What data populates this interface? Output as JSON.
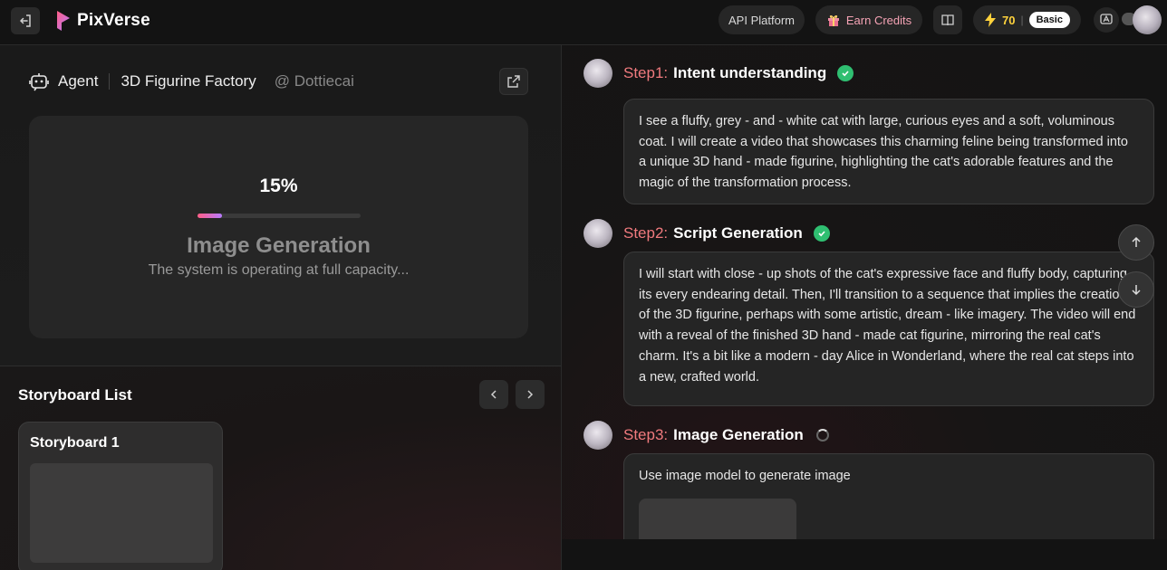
{
  "header": {
    "brand": "PixVerse",
    "api_platform": "API Platform",
    "earn_credits": "Earn Credits",
    "credits": "70",
    "plan": "Basic",
    "brand_gradient": [
      "#ff5e86",
      "#b77bff"
    ],
    "icons": {
      "back": "exit-icon",
      "gift": "gift-icon",
      "book": "book-icon",
      "bolt": "lightning-icon",
      "ai": "ai-assistant-icon"
    }
  },
  "agent": {
    "label": "Agent",
    "title": "3D Figurine Factory",
    "handle": "@ Dottiecai"
  },
  "generation": {
    "percent_text": "15%",
    "progress": 0.15,
    "title": "Image Generation",
    "subtitle": "The system is operating at full capacity..."
  },
  "storyboard": {
    "title": "Storyboard List",
    "cards": [
      {
        "title": "Storyboard 1"
      }
    ]
  },
  "steps": [
    {
      "num": "Step1:",
      "name": "Intent understanding",
      "status": "done",
      "text": "I see a fluffy, grey - and - white cat with large, curious eyes and a soft, voluminous coat. I will create a video that showcases this charming feline being transformed into a unique 3D hand - made figurine, highlighting the cat's adorable features and the magic of the transformation process."
    },
    {
      "num": "Step2:",
      "name": "Script Generation",
      "status": "done",
      "text": "I will start with close - up shots of the cat's expressive face and fluffy body, capturing its every endearing detail. Then, I'll transition to a sequence that implies the creation of the 3D figurine, perhaps with some artistic, dream - like imagery. The video will end with a reveal of the finished 3D hand - made cat figurine, mirroring the real cat's charm. It's a bit like a modern - day Alice in Wonderland, where the real cat steps into a new, crafted world."
    },
    {
      "num": "Step3:",
      "name": "Image Generation",
      "status": "loading",
      "text": "Use image model to generate image"
    }
  ]
}
